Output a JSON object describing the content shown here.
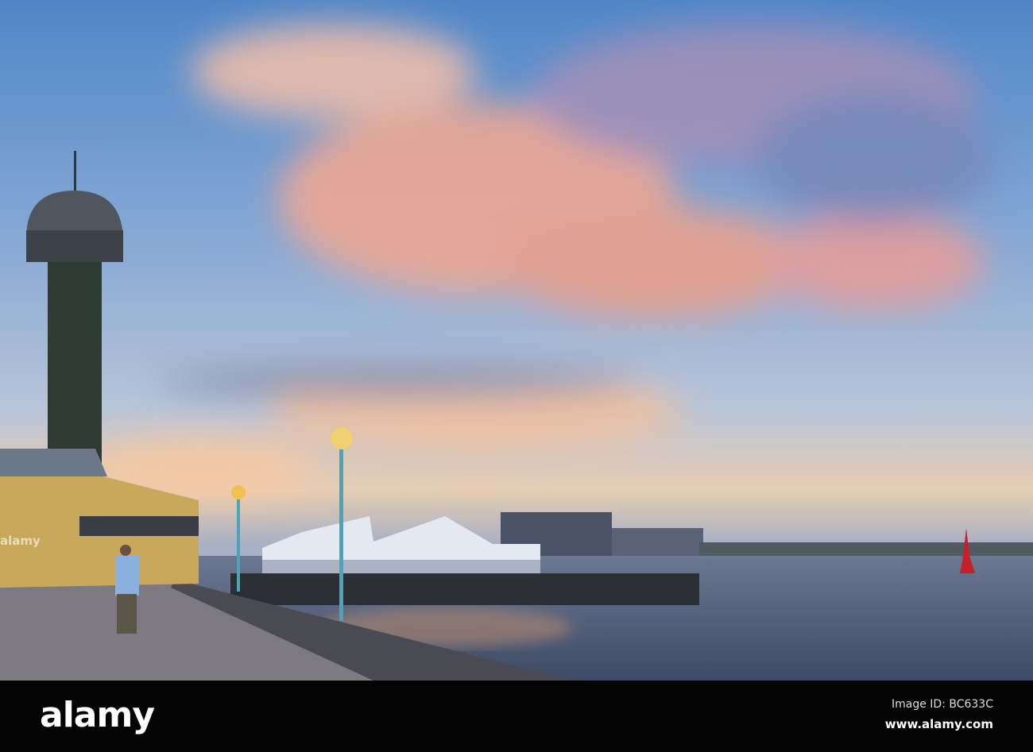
{
  "photo": {
    "subject": "waterfront promenade with observation tower at sunset"
  },
  "watermark": {
    "brand": "alamy"
  },
  "footer": {
    "logo": "alamy",
    "image_id": "Image ID: BC633C",
    "website": "www.alamy.com"
  }
}
